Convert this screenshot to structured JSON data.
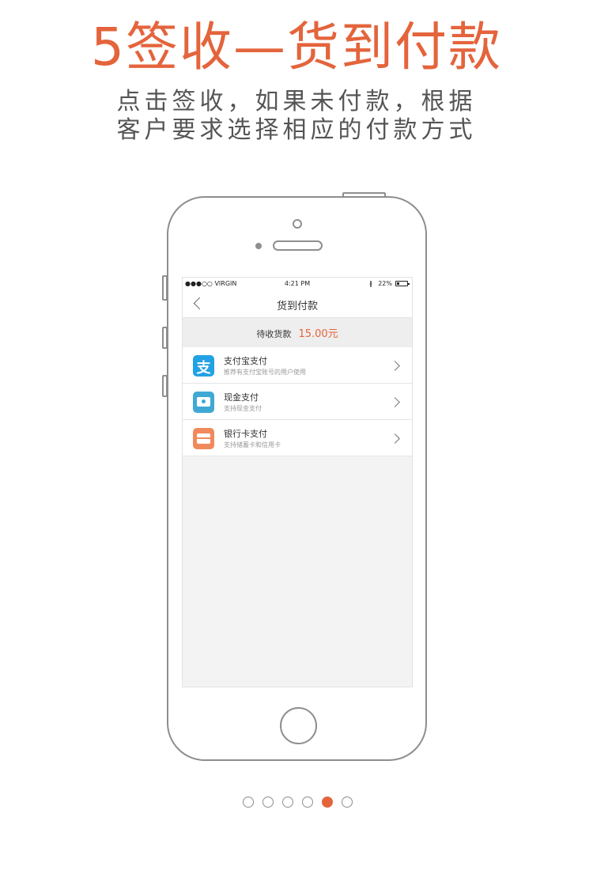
{
  "headline": "5签收—货到付款",
  "subtitle": {
    "line1": "点击签收，如果未付款，根据",
    "line2": "客户要求选择相应的付款方式"
  },
  "phone": {
    "status_bar": {
      "carrier": "●●●○○ VIRGIN",
      "time": "4:21 PM",
      "bluetooth": "∦",
      "battery": "22%"
    },
    "nav": {
      "title": "货到付款",
      "back_icon": "chevron-left-icon"
    },
    "amount": {
      "label": "待收货款",
      "value": "15.00元"
    },
    "methods": [
      {
        "title": "支付宝支付",
        "desc": "推荐有支付宝账号的用户使用",
        "icon": "alipay-icon",
        "glyph": "支",
        "color": "#22a2e4"
      },
      {
        "title": "现金支付",
        "desc": "支持现金支付",
        "icon": "cash-icon",
        "color": "#3fa9d4"
      },
      {
        "title": "银行卡支付",
        "desc": "支持储蓄卡和信用卡",
        "icon": "bank-card-icon",
        "color": "#f08a5d"
      }
    ]
  },
  "pagination": {
    "total": 6,
    "active_index": 4
  },
  "colors": {
    "accent": "#e4643c",
    "text_gray": "#555555"
  }
}
